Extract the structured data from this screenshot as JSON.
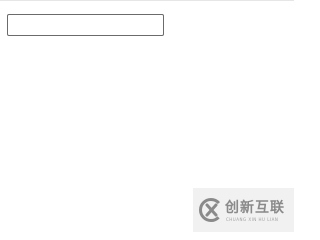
{
  "input": {
    "value": ""
  },
  "watermark": {
    "brand_cn": "创新互联",
    "brand_en": "CHUANG XIN HU LIAN",
    "icon": "x-logo-icon",
    "color": "#8a8a8a"
  }
}
